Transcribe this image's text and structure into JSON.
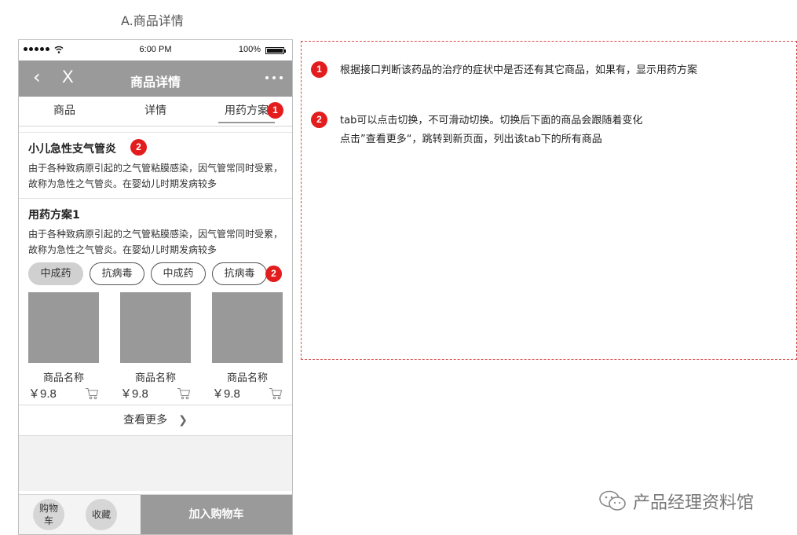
{
  "caption": "A.商品详情",
  "status_bar": {
    "time": "6:00 PM",
    "battery": "100%"
  },
  "nav": {
    "back": "‹",
    "close": "X",
    "title": "商品详情"
  },
  "tabs": [
    {
      "label": "商品"
    },
    {
      "label": "详情"
    },
    {
      "label": "用药方案"
    }
  ],
  "condition": {
    "title": "小儿急性支气管炎",
    "desc": "由于各种致病原引起的之气管粘膜感染，因气管常同时受累，故称为急性之气管炎。在婴幼儿时期发病较多"
  },
  "plan": {
    "title": "用药方案1",
    "desc": "由于各种致病原引起的之气管粘膜感染，因气管常同时受累，故称为急性之气管炎。在婴幼儿时期发病较多",
    "chips": [
      {
        "label": "中成药",
        "selected": true
      },
      {
        "label": "抗病毒",
        "selected": false
      },
      {
        "label": "中成药",
        "selected": false
      },
      {
        "label": "抗病毒",
        "selected": false
      }
    ]
  },
  "products": [
    {
      "name": "商品名称",
      "price": "￥9.8"
    },
    {
      "name": "商品名称",
      "price": "￥9.8"
    },
    {
      "name": "商品名称",
      "price": "￥9.8"
    }
  ],
  "view_more": {
    "label": "查看更多",
    "icon": "chevron-right-icon"
  },
  "bottom_bar": {
    "cart": "购物车",
    "favorite": "收藏",
    "add_to_cart": "加入购物车"
  },
  "badges": {
    "one": "1",
    "two": "2"
  },
  "notes": [
    {
      "num": "1",
      "lines": [
        "根据接口判断该药品的治疗的症状中是否还有其它商品，如果有，显示用药方案"
      ]
    },
    {
      "num": "2",
      "lines": [
        "tab可以点击切换，不可滑动切换。切换后下面的商品会跟随着变化",
        "点击”查看更多“，跳转到新页面，列出该tab下的所有商品"
      ]
    }
  ],
  "watermark": "产品经理资料馆",
  "colors": {
    "badge": "#e31d1d",
    "nav_bg": "#9a9a9a",
    "dashed_border": "#d94a4a"
  }
}
